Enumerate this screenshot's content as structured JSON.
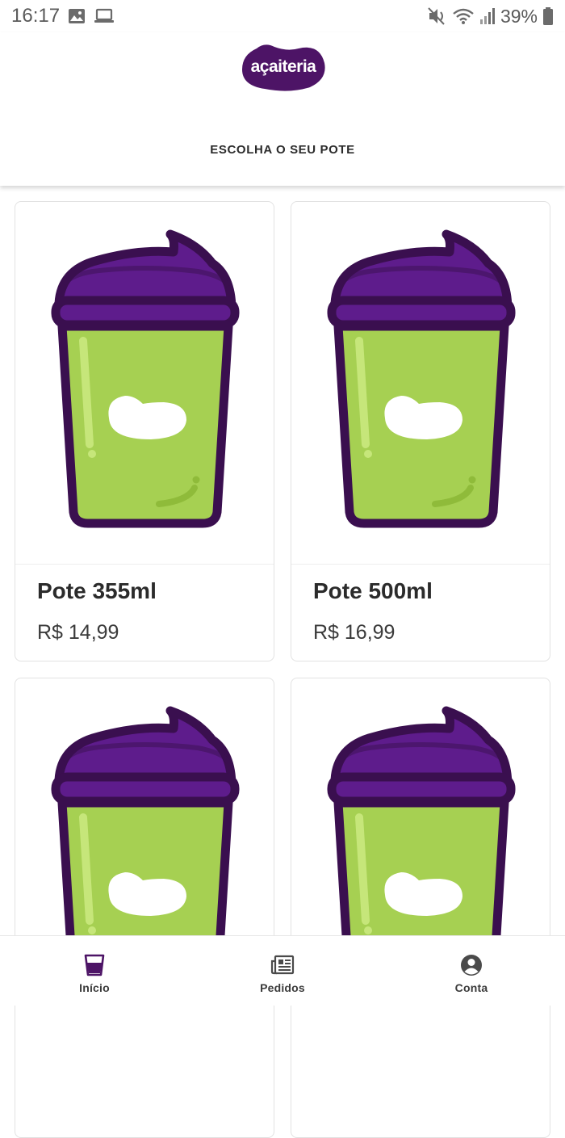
{
  "status_bar": {
    "time": "16:17",
    "battery": "39%",
    "icons": [
      "image-icon",
      "laptop-icon",
      "mute-icon",
      "wifi-icon",
      "signal-icon",
      "battery-icon"
    ]
  },
  "header": {
    "logo_text": "açaiteria",
    "title": "ESCOLHA O SEU POTE"
  },
  "colors": {
    "brand_purple": "#4d1466",
    "cream_purple": "#5e1c8c",
    "cup_green": "#a6d052",
    "cup_outline": "#3a0f4f"
  },
  "products": [
    {
      "name": "Pote 355ml",
      "price": "R$ 14,99",
      "icon": "acai-cup-icon"
    },
    {
      "name": "Pote 500ml",
      "price": "R$ 16,99",
      "icon": "acai-cup-icon"
    },
    {
      "name": "",
      "price": "",
      "icon": "acai-cup-icon"
    },
    {
      "name": "",
      "price": "",
      "icon": "acai-cup-icon"
    }
  ],
  "bottom_nav": {
    "items": [
      {
        "label": "Início",
        "icon": "cup-icon",
        "active": true
      },
      {
        "label": "Pedidos",
        "icon": "newspaper-icon",
        "active": false
      },
      {
        "label": "Conta",
        "icon": "account-icon",
        "active": false
      }
    ]
  }
}
